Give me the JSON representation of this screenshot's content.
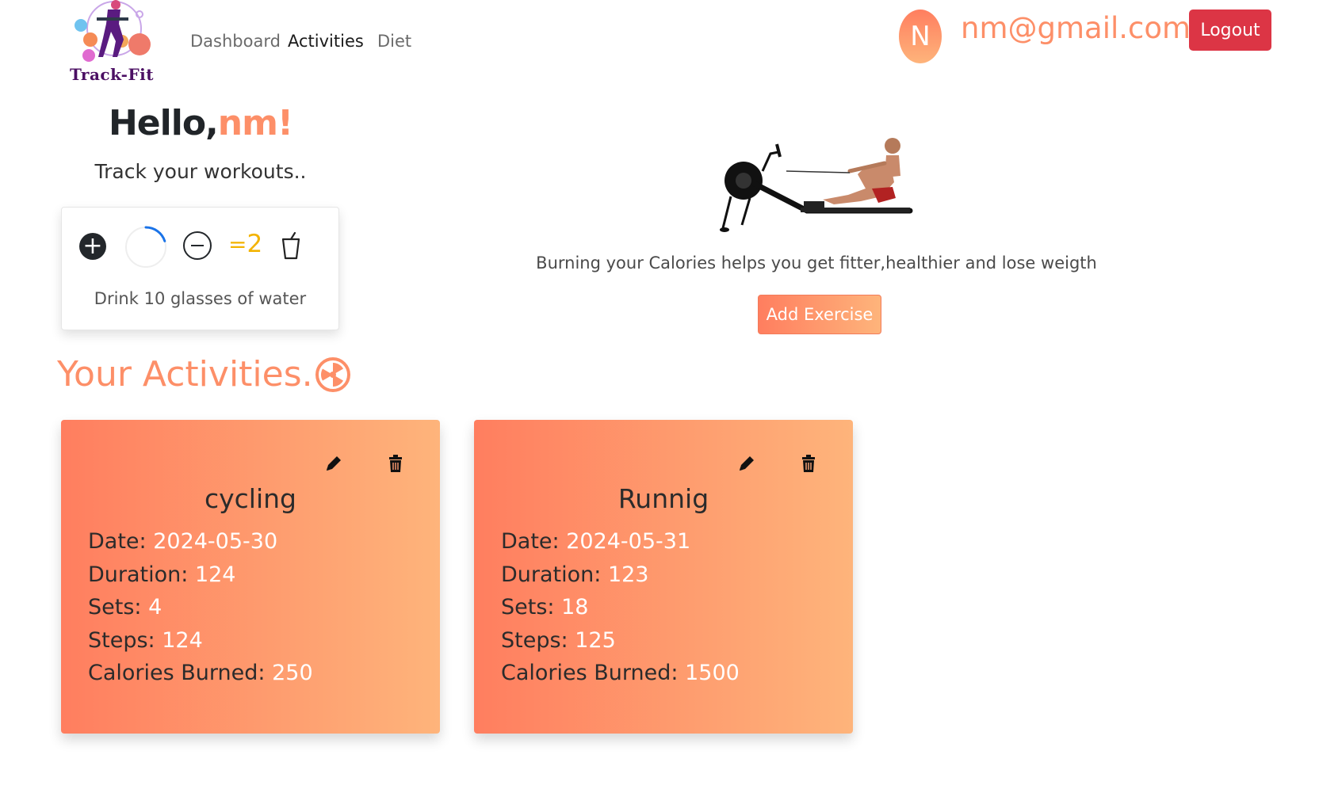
{
  "brand": {
    "logo_text": "Track-Fit"
  },
  "nav": {
    "links": [
      {
        "label": "Dashboard",
        "active": false
      },
      {
        "label": "Activities",
        "active": true
      },
      {
        "label": "Diet",
        "active": false
      }
    ]
  },
  "user": {
    "avatar_initial": "N",
    "email": "nm@gmail.com",
    "logout_label": "Logout"
  },
  "greeting": {
    "hello": "Hello,",
    "name": "nm!",
    "tagline": "Track your workouts.."
  },
  "water": {
    "count_prefix": "=",
    "count": "2",
    "label": "Drink 10 glasses of water",
    "goal": 10,
    "progress_fraction": 0.2,
    "icons": [
      "plus-circle-icon",
      "progress-ring",
      "minus-circle-icon",
      "cup-icon"
    ]
  },
  "hero": {
    "text": "Burning your Calories helps you get fitter,healthier and lose weigth",
    "add_button": "Add Exercise"
  },
  "activities": {
    "title": "Your Activities.",
    "field_labels": {
      "date": "Date: ",
      "duration": "Duration: ",
      "sets": "Sets: ",
      "steps": "Steps: ",
      "calories": "Calories Burned: "
    },
    "items": [
      {
        "name": "cycling",
        "date": "2024-05-30",
        "duration": "124",
        "sets": "4",
        "steps": "124",
        "calories": "250"
      },
      {
        "name": "Runnig",
        "date": "2024-05-31",
        "duration": "123",
        "sets": "18",
        "steps": "125",
        "calories": "1500"
      }
    ]
  },
  "colors": {
    "accent": "#fd8f68",
    "gradient_start": "#ff7e5f",
    "gradient_end": "#feb47b",
    "logout": "#dc3545",
    "water_count": "#f3b300",
    "progress": "#1a73e8"
  }
}
